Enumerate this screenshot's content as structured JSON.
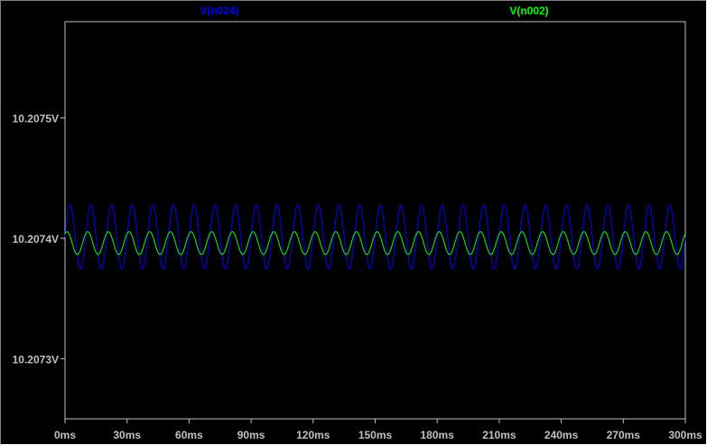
{
  "chart_data": {
    "type": "line",
    "title": "",
    "xlabel": "",
    "ylabel": "",
    "grid": false,
    "legend_placement": "top",
    "background_color": "#000000",
    "axis_color": "#c0c0c0",
    "xlim": [
      0,
      300
    ],
    "x_unit": "ms",
    "x_ticks": [
      0,
      30,
      60,
      90,
      120,
      150,
      180,
      210,
      240,
      270,
      300
    ],
    "x_tick_labels": [
      "0ms",
      "30ms",
      "60ms",
      "90ms",
      "120ms",
      "150ms",
      "180ms",
      "210ms",
      "240ms",
      "270ms",
      "300ms"
    ],
    "ylim": [
      10.20725,
      10.20758
    ],
    "y_ticks": [
      10.2073,
      10.2074,
      10.2075
    ],
    "y_tick_labels": [
      "10.2073V",
      "10.2074V",
      "10.2075V"
    ],
    "series": [
      {
        "name": "V(n024)",
        "color": "#0000ff",
        "waveform": "sine",
        "offset": 10.207401,
        "amplitude": 2.65e-05,
        "period_ms": 10,
        "phase_deg": 0
      },
      {
        "name": "V(n002)",
        "color": "#00ff00",
        "waveform": "sine",
        "offset": 10.207396,
        "amplitude": 9.5e-06,
        "period_ms": 10,
        "phase_deg": 55
      }
    ]
  }
}
